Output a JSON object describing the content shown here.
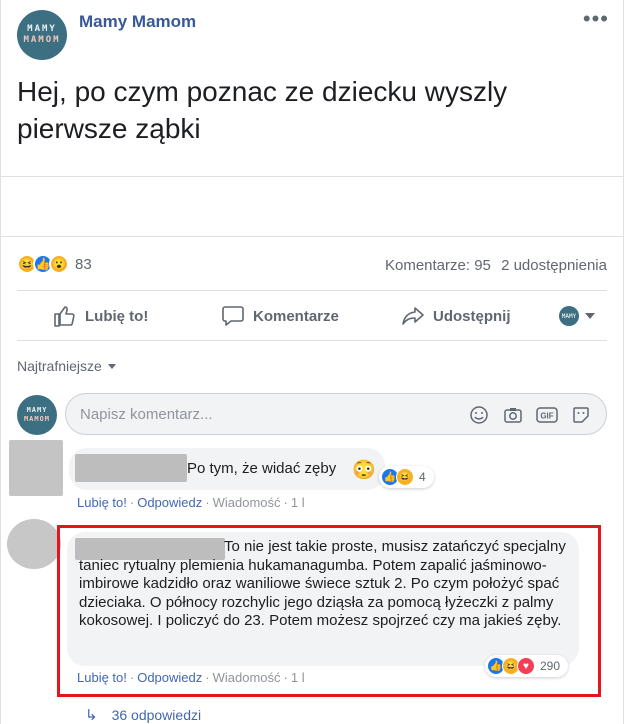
{
  "post": {
    "page_name": "Mamy Mamom",
    "avatar_line1": "MAMY",
    "avatar_line2": "MAMOM",
    "text": "Hej, po czym poznac ze dziecku wyszly pierwsze ząbki",
    "more_icon": "more-horizontal-icon"
  },
  "stats": {
    "reactions": [
      "haha",
      "like",
      "wow"
    ],
    "reaction_count": "83",
    "comments": "Komentarze: 95",
    "shares": "2 udostępnienia"
  },
  "actions": {
    "like": "Lubię to!",
    "comment": "Komentarze",
    "share": "Udostępnij"
  },
  "comments_section": {
    "sort_label": "Najtrafniejsze",
    "input_placeholder": "Napisz komentarz...",
    "input_icons": [
      "emoji-icon",
      "camera-icon",
      "gif-icon",
      "sticker-icon"
    ]
  },
  "comments": [
    {
      "text": "Po tym, że widać zęby",
      "emoji": "😳",
      "reactions": [
        "like",
        "haha"
      ],
      "reaction_count": "4",
      "like_label": "Lubię to!",
      "reply_label": "Odpowiedz",
      "message_label": "Wiadomość",
      "time": "1 l"
    },
    {
      "text": "To nie jest takie proste, musisz zatańczyć specjalny taniec rytualny plemienia hukamanagumba. Potem zapalić jaśminowo-imbirowe kadzidło oraz waniliowe świece sztuk 2. Po czym położyć spać dzieciaka. O północy rozchylic jego dziąsła za pomocą łyżeczki z palmy kokosowej. I policzyć do 23. Potem możesz spojrzeć czy ma jakieś zęby.",
      "reactions": [
        "like",
        "haha",
        "love"
      ],
      "reaction_count": "290",
      "like_label": "Lubię to!",
      "reply_label": "Odpowiedz",
      "message_label": "Wiadomość",
      "time": "1 l",
      "replies_label": "36 odpowiedzi"
    }
  ],
  "colors": {
    "link": "#385898",
    "meta_link": "#4267b2",
    "highlight": "#e8141c",
    "bubble": "#f2f3f5"
  }
}
